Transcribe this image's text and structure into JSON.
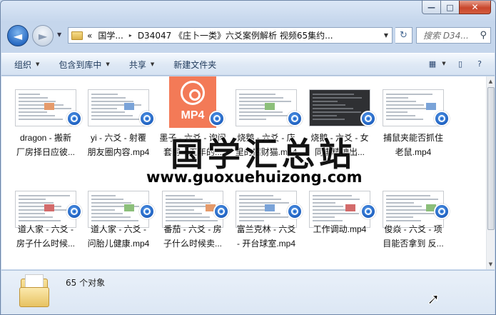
{
  "window": {
    "caption": {
      "minimize": "—",
      "maximize": "□",
      "close": "✕"
    }
  },
  "navigation": {
    "back_icon": "◄",
    "forward_icon": "►",
    "address": {
      "overflow": "«",
      "segments": [
        "国学...",
        "D34047 《庄卜一类》六爻案例解析 视频65集约..."
      ],
      "separator": "▸"
    },
    "search": {
      "placeholder": "搜索 D34...",
      "icon": "search-icon"
    }
  },
  "toolbar": {
    "items": [
      {
        "label": "组织",
        "dropdown": true
      },
      {
        "label": "包含到库中",
        "dropdown": true
      },
      {
        "label": "共享",
        "dropdown": true
      },
      {
        "label": "新建文件夹",
        "dropdown": false
      }
    ]
  },
  "files": [
    {
      "name": "dragon - 搬新\n厂房择日应彼...",
      "thumb": "doc"
    },
    {
      "name": "yi - 六爻 - 射覆\n朋友圈内容.mp4",
      "thumb": "doc"
    },
    {
      "name": "墨子 - 六爻 - 询问\n套房一五年的...",
      "thumb": "mp4",
      "thumb_label": "MP4"
    },
    {
      "name": "烧鹅 - 六爻 - 店\n里的招财猫.mp4",
      "thumb": "doc"
    },
    {
      "name": "烧鹅 - 六爻 - 女\n同事精神出...",
      "thumb": "dark"
    },
    {
      "name": "捕鼠夹能否抓住\n老鼠.mp4",
      "thumb": "doc"
    },
    {
      "name": "道人家 - 六爻 -\n房子什么时候...",
      "thumb": "doc"
    },
    {
      "name": "道人家 - 六爻 -\n问胎儿健康.mp4",
      "thumb": "doc"
    },
    {
      "name": "番茄 - 六爻 - 房\n子什么时候卖...",
      "thumb": "doc"
    },
    {
      "name": "富兰克林 - 六爻\n- 开台球室.mp4",
      "thumb": "doc"
    },
    {
      "name": "工作调动.mp4",
      "thumb": "doc"
    },
    {
      "name": "俊焱 - 六爻 - 项\n目能否拿到 反...",
      "thumb": "doc"
    }
  ],
  "watermark": {
    "title": "国学汇总站",
    "url": "www.guoxuehuizong.com"
  },
  "details": {
    "count_text": "65 个对象"
  },
  "colors": {
    "accent": "#2a6cc4",
    "mp4_orange": "#f37a57",
    "toolbar_text": "#1e395b"
  }
}
